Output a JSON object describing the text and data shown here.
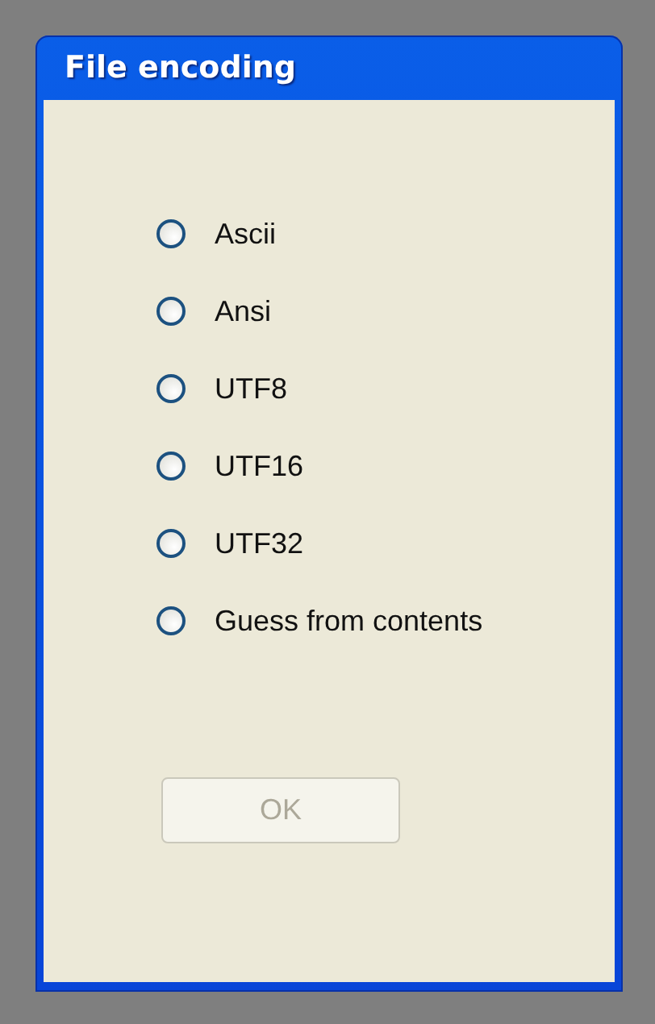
{
  "window": {
    "title": "File encoding"
  },
  "options": [
    {
      "label": "Ascii",
      "selected": false
    },
    {
      "label": "Ansi",
      "selected": false
    },
    {
      "label": "UTF8",
      "selected": false
    },
    {
      "label": "UTF16",
      "selected": false
    },
    {
      "label": "UTF32",
      "selected": false
    },
    {
      "label": "Guess from contents",
      "selected": false
    }
  ],
  "ok_button": {
    "label": "OK",
    "disabled": true
  }
}
